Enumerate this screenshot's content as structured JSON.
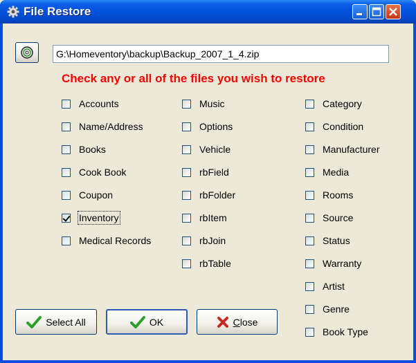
{
  "window": {
    "title": "File Restore"
  },
  "path": {
    "value": "G:\\Homeventory\\backup\\Backup_2007_1_4.zip"
  },
  "instruction": "Check any or all of the files you wish to restore",
  "columns": [
    [
      {
        "label": "Accounts",
        "checked": false
      },
      {
        "label": "Name/Address",
        "checked": false
      },
      {
        "label": "Books",
        "checked": false
      },
      {
        "label": "Cook Book",
        "checked": false
      },
      {
        "label": "Coupon",
        "checked": false
      },
      {
        "label": "Inventory",
        "checked": true
      },
      {
        "label": "Medical Records",
        "checked": false
      }
    ],
    [
      {
        "label": "Music",
        "checked": false
      },
      {
        "label": "Options",
        "checked": false
      },
      {
        "label": "Vehicle",
        "checked": false
      },
      {
        "label": "rbField",
        "checked": false
      },
      {
        "label": "rbFolder",
        "checked": false
      },
      {
        "label": "rbItem",
        "checked": false
      },
      {
        "label": "rbJoin",
        "checked": false
      },
      {
        "label": "rbTable",
        "checked": false
      }
    ],
    [
      {
        "label": "Category",
        "checked": false
      },
      {
        "label": "Condition",
        "checked": false
      },
      {
        "label": "Manufacturer",
        "checked": false
      },
      {
        "label": "Media",
        "checked": false
      },
      {
        "label": "Rooms",
        "checked": false
      },
      {
        "label": "Source",
        "checked": false
      },
      {
        "label": "Status",
        "checked": false
      },
      {
        "label": "Warranty",
        "checked": false
      },
      {
        "label": "Artist",
        "checked": false
      },
      {
        "label": "Genre",
        "checked": false
      },
      {
        "label": "Book Type",
        "checked": false
      }
    ]
  ],
  "buttons": {
    "select_all": "Select All",
    "ok": "OK",
    "close_hotkey": "C",
    "close_rest": "lose"
  },
  "colors": {
    "instruction": "#ff0000",
    "titlebar": "#0451d8",
    "check_icon": "#2aa02a",
    "close_icon": "#c8281e"
  }
}
